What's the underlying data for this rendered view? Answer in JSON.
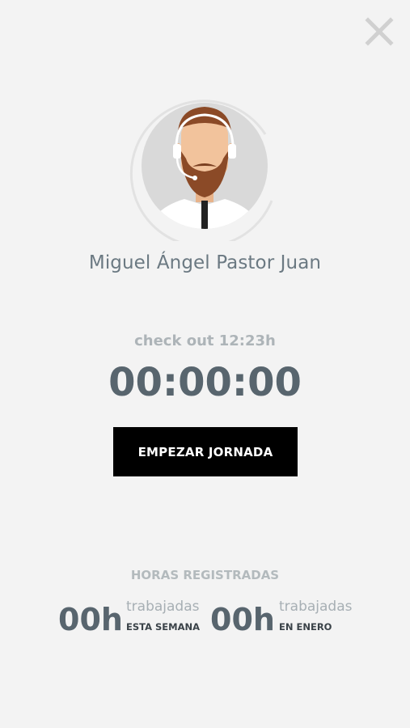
{
  "header": {
    "close_icon": "close-icon"
  },
  "profile": {
    "name": "Miguel Ángel Pastor Juan",
    "avatar_icon": "agent-headset-avatar"
  },
  "status": {
    "checkout_text": "check out 12:23h",
    "timer": "00:00:00"
  },
  "actions": {
    "start_label": "EMPEZAR JORNADA"
  },
  "hours": {
    "title": "HORAS REGISTRADAS",
    "stats": [
      {
        "value": "00h",
        "sub": "trabajadas",
        "period": "ESTA SEMANA"
      },
      {
        "value": "00h",
        "sub": "trabajadas",
        "period": "EN ENERO"
      }
    ]
  },
  "colors": {
    "background": "#f3f3f3",
    "button": "#000000",
    "primary_text": "#58656e",
    "muted_text": "#adb4b8"
  }
}
